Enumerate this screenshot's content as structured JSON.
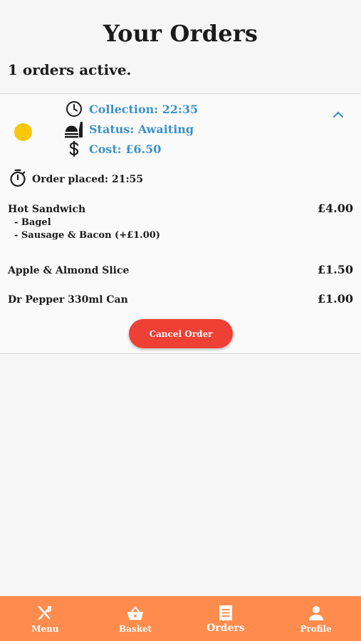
{
  "page": {
    "title": "Your Orders",
    "active_count": "1 orders active."
  },
  "order": {
    "status_color": "#f9c80e",
    "collection": "Collection: 22:35",
    "status": "Status: Awaiting",
    "cost": "Cost: £6.50",
    "placed": "Order placed: 21:55",
    "items": [
      {
        "name": "Hot Sandwich",
        "price": "£4.00",
        "options": [
          "- Bagel",
          "- Sausage & Bacon (+£1.00)"
        ]
      },
      {
        "name": "Apple & Almond Slice",
        "price": "£1.50"
      },
      {
        "name": "Dr Pepper 330ml Can",
        "price": "£1.00"
      }
    ],
    "cancel_label": "Cancel Order"
  },
  "nav": {
    "accent": "#ff8c4d",
    "items": [
      {
        "label": "Menu",
        "icon": "cutlery-icon"
      },
      {
        "label": "Basket",
        "icon": "basket-icon"
      },
      {
        "label": "Orders",
        "icon": "receipt-icon"
      },
      {
        "label": "Profile",
        "icon": "person-icon"
      }
    ]
  }
}
